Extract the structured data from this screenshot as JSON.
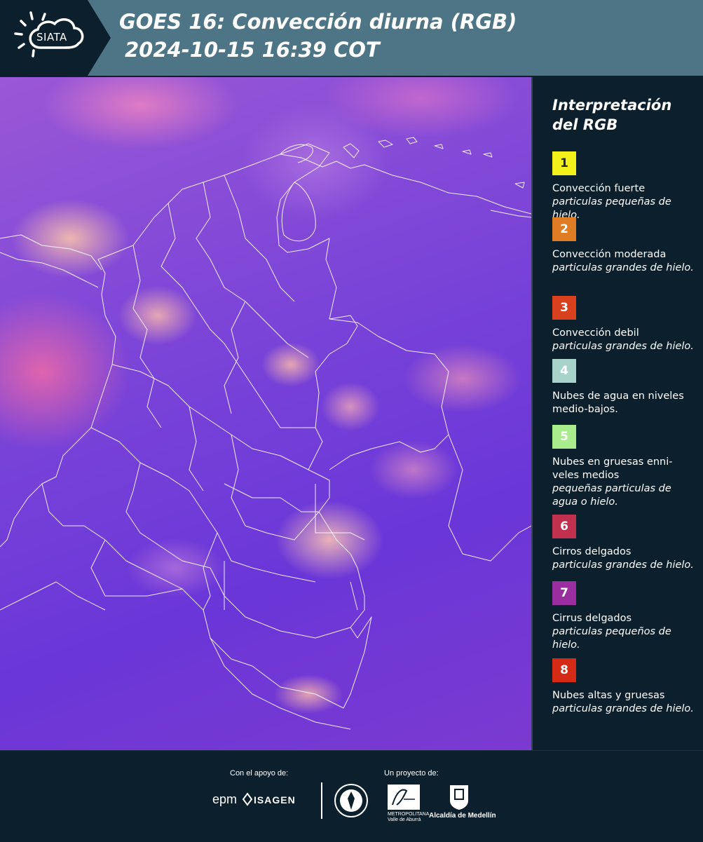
{
  "header": {
    "logo_text": "SIATA",
    "title_line1": "GOES 16: Convección diurna (RGB)",
    "title_line2": "2024-10-15 16:39 COT",
    "color": "#4e7586"
  },
  "legend": {
    "title": "Interpretación del RGB",
    "items": [
      {
        "number": "1",
        "color": "#f2f21a",
        "text_color": "#2a2a10",
        "label": "Convección fuerte",
        "sub": "particulas pequeñas de hielo."
      },
      {
        "number": "2",
        "color": "#e07c24",
        "text_color": "#ffffff",
        "label": "Convección moderada",
        "sub": "particulas grandes de hielo."
      },
      {
        "number": "3",
        "color": "#d8401e",
        "text_color": "#ffffff",
        "label": "Convección debil",
        "sub": "particulas grandes de hielo."
      },
      {
        "number": "4",
        "color": "#a7d3ca",
        "text_color": "#ffffff",
        "label": "Nubes de agua en niveles medio-bajos.",
        "sub": ""
      },
      {
        "number": "5",
        "color": "#a9ec8e",
        "text_color": "#ffffff",
        "label": "Nubes en gruesas enni-veles medios",
        "sub": "pequeñas particulas de agua o hielo."
      },
      {
        "number": "6",
        "color": "#c1304e",
        "text_color": "#ffffff",
        "label": "Cirros delgados",
        "sub": "particulas grandes de hielo."
      },
      {
        "number": "7",
        "color": "#9a2ea0",
        "text_color": "#ffffff",
        "label": "Cirrus delgados",
        "sub": "particulas pequeños de hielo."
      },
      {
        "number": "8",
        "color": "#d42a16",
        "text_color": "#ffffff",
        "label": "Nubes altas y gruesas",
        "sub": "particulas grandes de hielo."
      }
    ]
  },
  "footer": {
    "support_label": "Con el apoyo de:",
    "project_label": "Un proyecto de:",
    "sponsor1": "epm",
    "sponsor2": "ISAGEN",
    "partner_amva": "METROPOLITANA Valle de Aburrá",
    "partner_amva_script": "Área",
    "partner_medellin": "Alcaldía de Medellín"
  }
}
